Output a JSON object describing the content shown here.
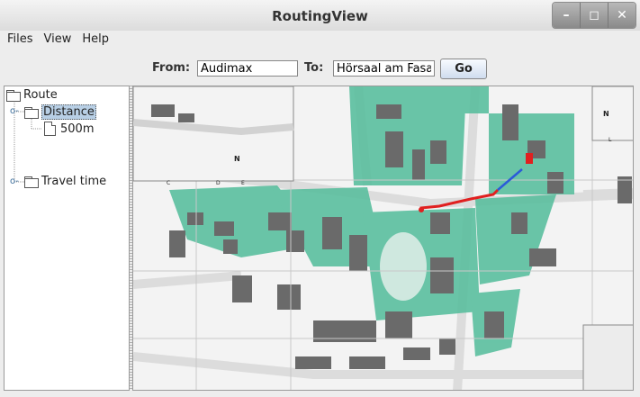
{
  "window": {
    "title": "RoutingView"
  },
  "titlebar": {
    "minimize": "–",
    "maximize": "◻",
    "close": "✕"
  },
  "menu": [
    "Files",
    "View",
    "Help"
  ],
  "route": {
    "from_label": "From:",
    "from_value": "Audimax",
    "to_label": "To:",
    "to_value": "Hörsaal am Fasan",
    "go_label": "Go"
  },
  "tree": {
    "root": "Route",
    "distance": "Distance",
    "distance_value": "500m",
    "travel_time": "Travel time"
  },
  "map": {
    "grid_letters": [
      "C",
      "D",
      "E",
      "L"
    ],
    "north": "N",
    "colors": {
      "greenery": "#5bbf9f",
      "building": "#6a6a6a",
      "route": "#e02020",
      "route_end": "#2b5bd8"
    }
  }
}
